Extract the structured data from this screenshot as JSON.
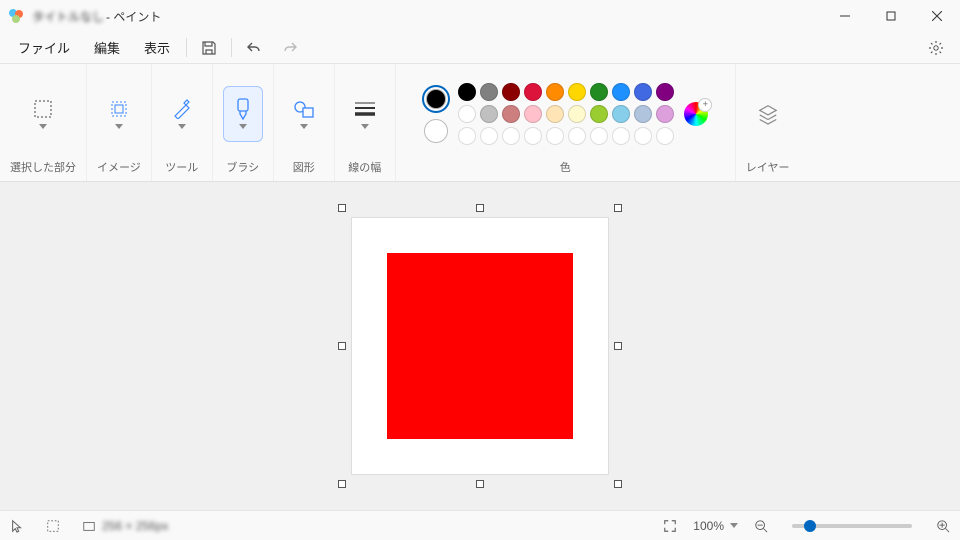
{
  "title": {
    "filename": "タイトルなし",
    "suffix": " - ペイント"
  },
  "menu": {
    "file": "ファイル",
    "edit": "編集",
    "view": "表示"
  },
  "ribbon": {
    "selection": "選択した部分",
    "image": "イメージ",
    "tools": "ツール",
    "brushes": "ブラシ",
    "shapes": "図形",
    "line_width": "線の幅",
    "colors": "色",
    "layers": "レイヤー"
  },
  "colors": {
    "primary": "#000000",
    "secondary": "#ffffff",
    "row1": [
      "#000000",
      "#808080",
      "#8b0000",
      "#dc143c",
      "#ff8c00",
      "#ffd700",
      "#228b22",
      "#1e90ff",
      "#4169e1",
      "#800080"
    ],
    "row2": [
      "#ffffff",
      "#c0c0c0",
      "#cd7f7f",
      "#ffc0cb",
      "#ffe4b5",
      "#fffacd",
      "#9acd32",
      "#87ceeb",
      "#b0c4de",
      "#dda0dd"
    ]
  },
  "canvas": {
    "shape_color": "#ff0000"
  },
  "status": {
    "cursor": "",
    "selection": "",
    "canvas_size": "256 × 256px",
    "zoom": "100%"
  }
}
